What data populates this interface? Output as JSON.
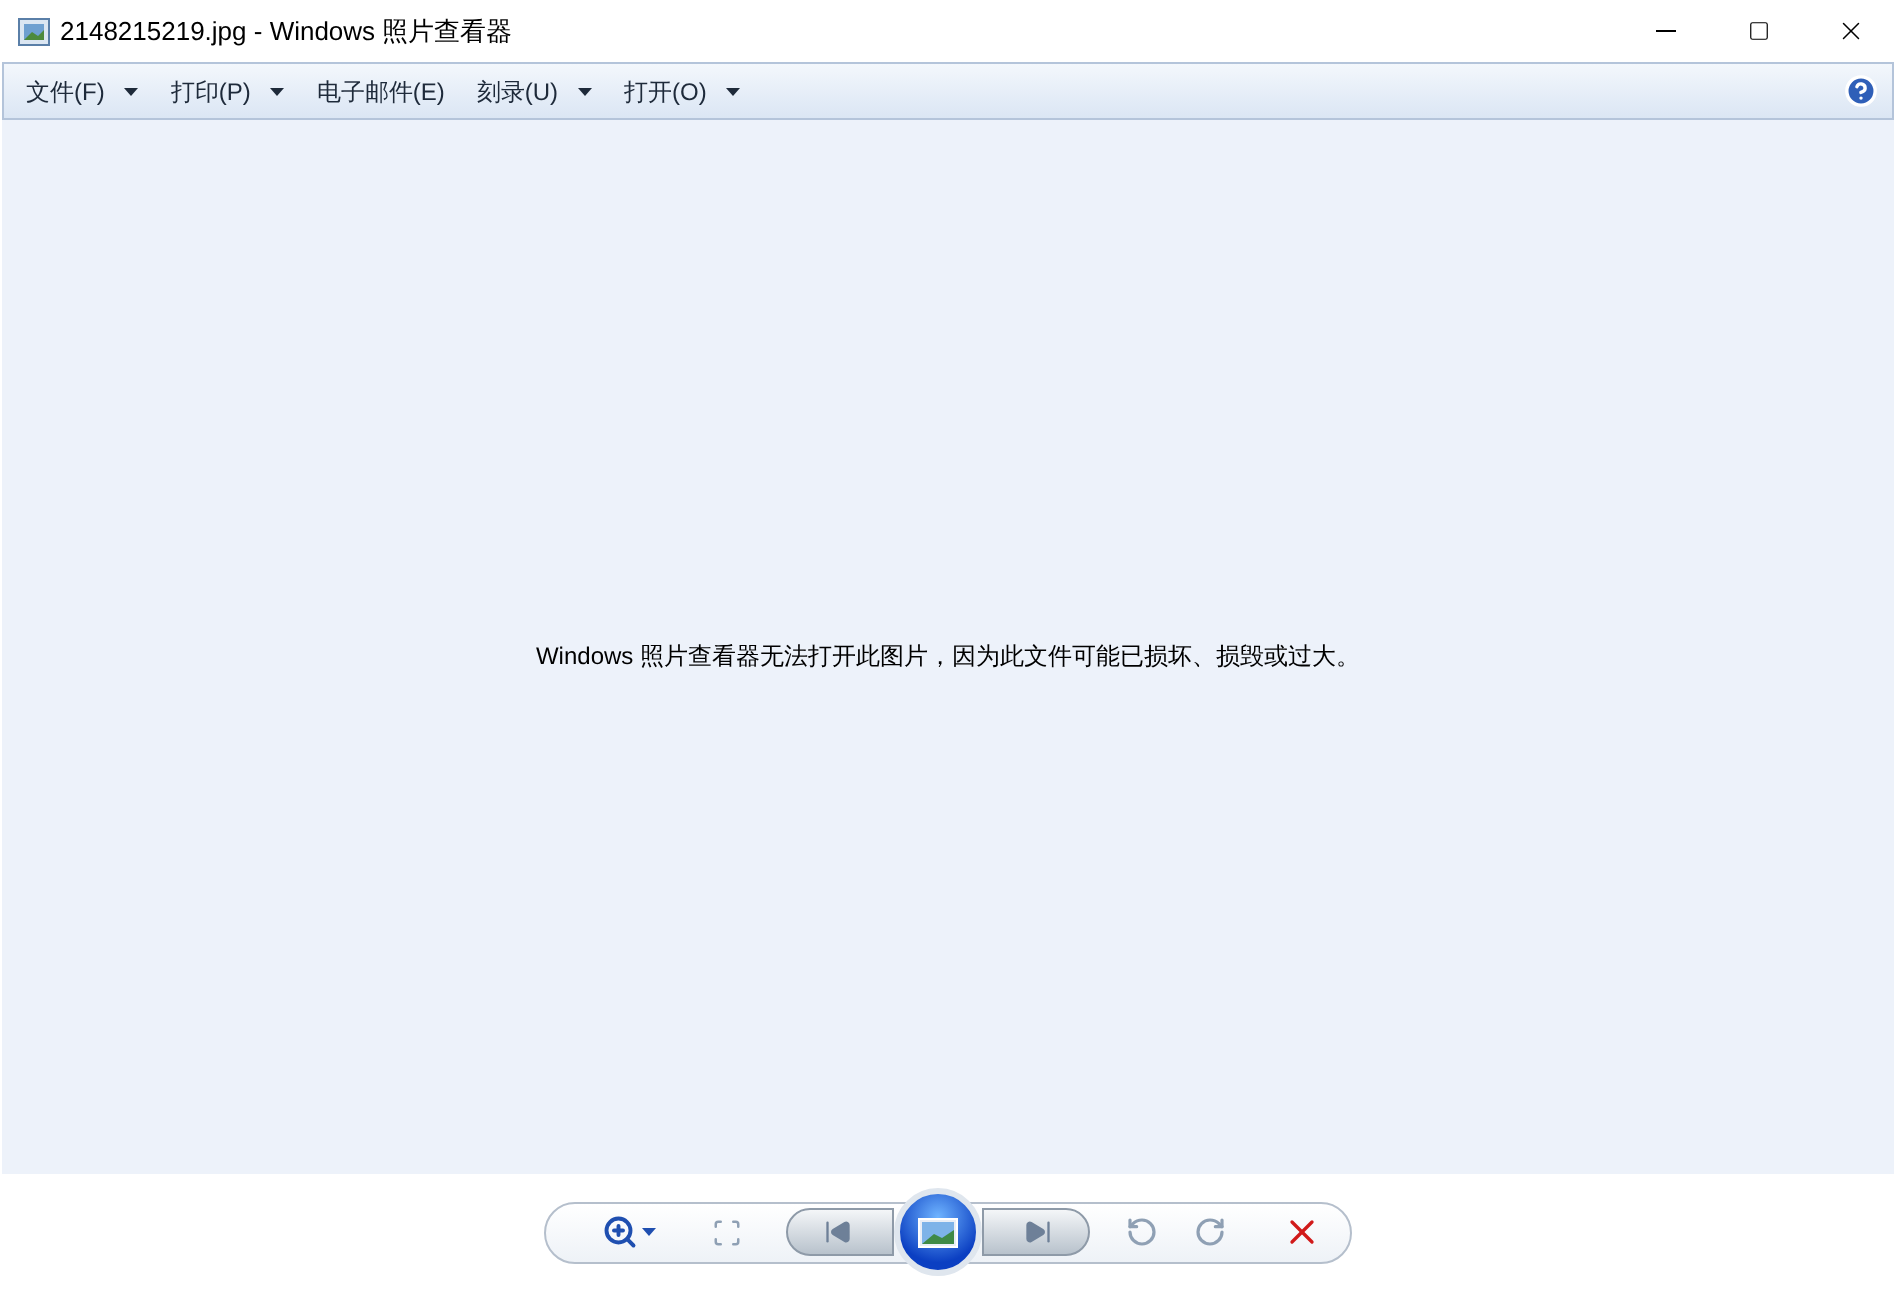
{
  "window": {
    "title": "2148215219.jpg - Windows 照片查看器"
  },
  "menu": [
    {
      "label": "文件(F)",
      "has_dropdown": true
    },
    {
      "label": "打印(P)",
      "has_dropdown": true
    },
    {
      "label": "电子邮件(E)",
      "has_dropdown": false
    },
    {
      "label": "刻录(U)",
      "has_dropdown": true
    },
    {
      "label": "打开(O)",
      "has_dropdown": true
    }
  ],
  "message": "Windows 照片查看器无法打开此图片，因为此文件可能已损坏、损毁或过大。"
}
